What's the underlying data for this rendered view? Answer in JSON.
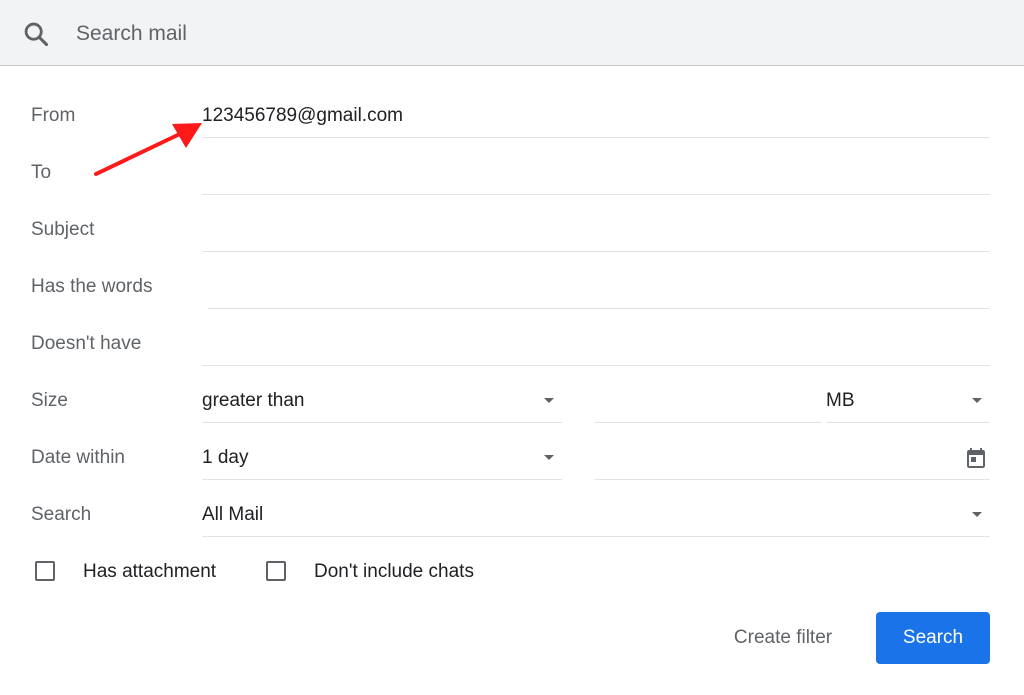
{
  "search": {
    "placeholder": "Search mail",
    "icon": "search-icon"
  },
  "form": {
    "from": {
      "label": "From",
      "value": "123456789@gmail.com"
    },
    "to": {
      "label": "To",
      "value": ""
    },
    "subject": {
      "label": "Subject",
      "value": ""
    },
    "has_words": {
      "label": "Has the words",
      "value": ""
    },
    "doesnt_have": {
      "label": "Doesn't have",
      "value": ""
    },
    "size": {
      "label": "Size",
      "operator": "greater than",
      "value": "",
      "unit": "MB"
    },
    "date_within": {
      "label": "Date within",
      "value": "1 day",
      "date": "",
      "icon": "calendar-icon"
    },
    "search_in": {
      "label": "Search",
      "value": "All Mail"
    }
  },
  "checkboxes": {
    "has_attachment": {
      "label": "Has attachment",
      "checked": false
    },
    "no_chats": {
      "label": "Don't include chats",
      "checked": false
    }
  },
  "actions": {
    "create_filter": "Create filter",
    "search": "Search"
  },
  "colors": {
    "accent": "#1a73e8",
    "annotation_arrow": "#ff0000",
    "searchbar_bg": "#f1f3f4"
  }
}
